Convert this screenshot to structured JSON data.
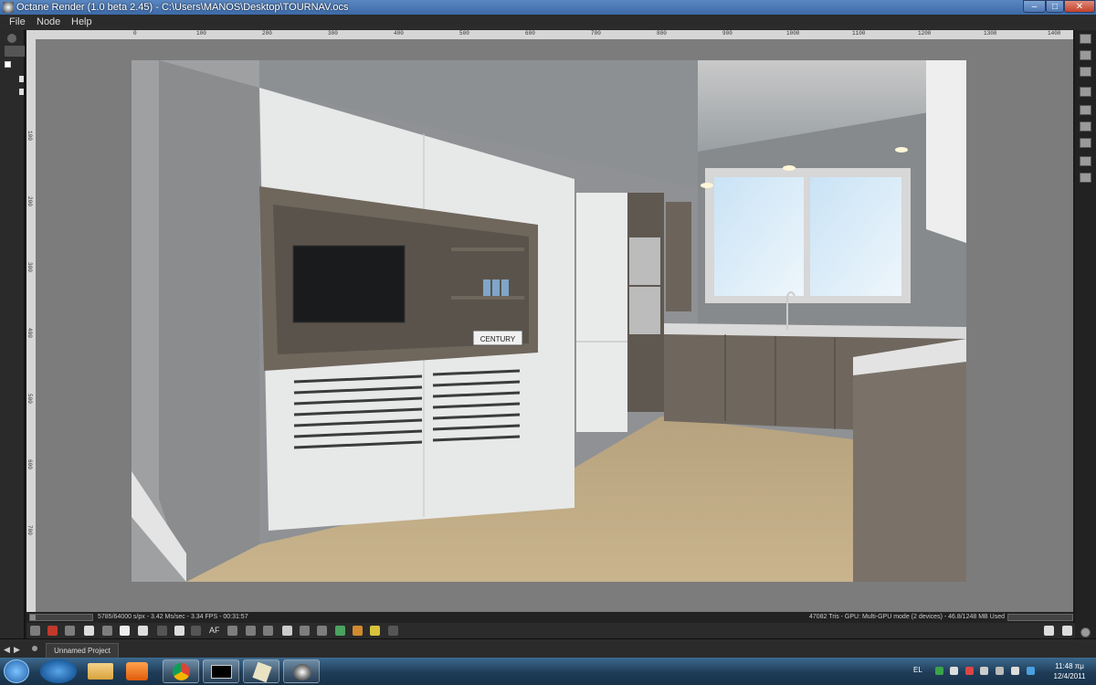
{
  "window": {
    "title": "Octane Render (1.0 beta 2.45) - C:\\Users\\MANOS\\Desktop\\TOURNAV.ocs"
  },
  "menu": [
    "File",
    "Node",
    "Help"
  ],
  "ruler": {
    "top_ticks": [
      "0",
      "100",
      "200",
      "300",
      "400",
      "500",
      "600",
      "700",
      "800",
      "900",
      "1000",
      "1100",
      "1200",
      "1300",
      "1400"
    ],
    "left_ticks": [
      "100",
      "200",
      "300",
      "400",
      "500",
      "600",
      "700"
    ]
  },
  "render": {
    "shelf_label": "CENTURY"
  },
  "status": {
    "left": "5785/64000 s/px - 3.42 Ms/sec - 3.34 FPS - 00:31:57",
    "right": "47082 Tris - GPU: Multi-GPU mode (2 devices) - 46.8/1248 MB Used",
    "progress": 0.09
  },
  "toolbar": {
    "af_label": "AF"
  },
  "project_tab": "Unnamed Project",
  "taskbar": {
    "language": "EL",
    "time": "11:48 πμ",
    "date": "12/4/2011"
  },
  "colors": {
    "title_bar": "#3c6aa8",
    "taskbar": "#1f3c57",
    "viewport_bg": "#7c7c7c"
  }
}
